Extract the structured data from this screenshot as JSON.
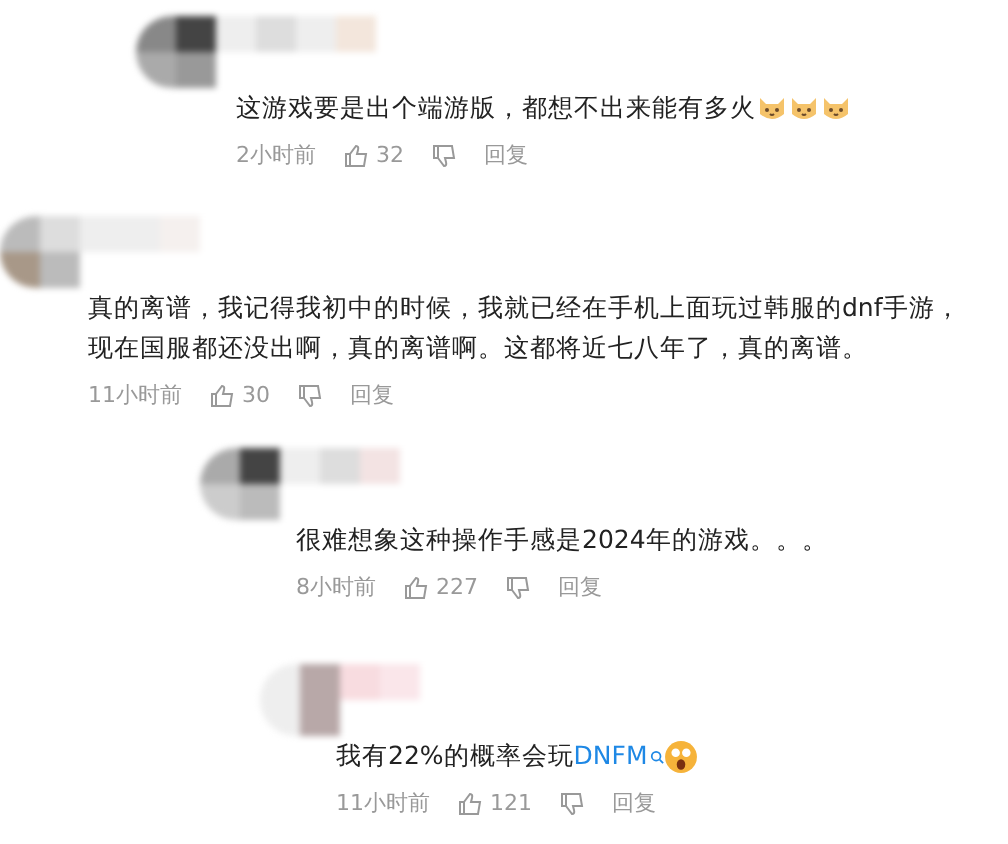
{
  "comments": [
    {
      "text": "这游戏要是出个端游版，都想不出来能有多火",
      "emojis": [
        {
          "kind": "cat"
        },
        {
          "kind": "cat"
        },
        {
          "kind": "cat"
        }
      ],
      "time": "2小时前",
      "likes": "32",
      "reply": "回复"
    },
    {
      "text": "真的离谱，我记得我初中的时候，我就已经在手机上面玩过韩服的dnf手游，现在国服都还没出啊，真的离谱啊。这都将近七八年了，真的离谱。",
      "time": "11小时前",
      "likes": "30",
      "reply": "回复"
    },
    {
      "text": "很难想象这种操作手感是2024年的游戏。。。",
      "time": "8小时前",
      "likes": "227",
      "reply": "回复"
    },
    {
      "text": "我有22%的概率会玩",
      "link": "DNFM",
      "emojis": [
        {
          "kind": "shocked"
        }
      ],
      "time": "11小时前",
      "likes": "121",
      "reply": "回复"
    }
  ]
}
